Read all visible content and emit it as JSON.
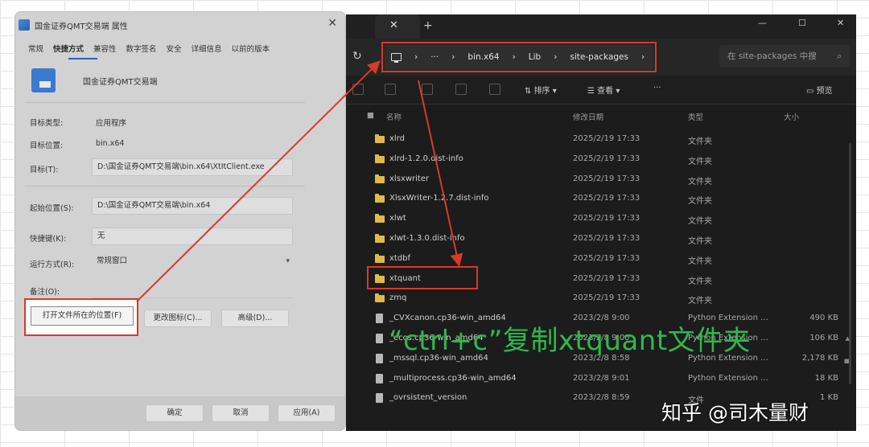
{
  "dialog": {
    "title": "国金证券QMT交易端 属性",
    "close_label": "✕",
    "tabs": [
      "常规",
      "快捷方式",
      "兼容性",
      "数字签名",
      "安全",
      "详细信息",
      "以前的版本"
    ],
    "app_name": "国金证券QMT交易端",
    "fields": {
      "target_type_label": "目标类型:",
      "target_type_value": "应用程序",
      "target_location_label": "目标位置:",
      "target_location_value": "bin.x64",
      "target_label": "目标(T):",
      "target_value": "D:\\国金证券QMT交易端\\bin.x64\\XtItClient.exe",
      "start_in_label": "起始位置(S):",
      "start_in_value": "D:\\国金证券QMT交易端\\bin.x64",
      "shortcut_key_label": "快捷键(K):",
      "shortcut_key_value": "无",
      "run_label": "运行方式(R):",
      "run_value": "常规窗口",
      "comment_label": "备注(O):",
      "comment_value": ""
    },
    "buttons": {
      "open_location": "打开文件所在的位置(F)",
      "change_icon": "更改图标(C)...",
      "advanced": "高级(D)..."
    },
    "footer": {
      "ok": "确定",
      "cancel": "取消",
      "apply": "应用(A)"
    }
  },
  "explorer": {
    "tab_close": "✕",
    "tab_add": "+",
    "window_controls": [
      "—",
      "☐",
      "✕"
    ],
    "breadcrumb": [
      "›",
      "···",
      "›",
      "bin.x64",
      "›",
      "Lib",
      "›",
      "site-packages",
      "›"
    ],
    "search_placeholder": "在 site-packages 中搜",
    "toolbar": {
      "sort": "排序",
      "view": "查看",
      "more": "···",
      "details": "预览"
    },
    "columns": {
      "name": "名称",
      "date": "修改日期",
      "type": "类型",
      "size": "大小"
    },
    "rows": [
      {
        "name": "xlrd",
        "date": "2025/2/19 17:33",
        "type": "文件夹",
        "size": "",
        "kind": "folder"
      },
      {
        "name": "xlrd-1.2.0.dist-info",
        "date": "2025/2/19 17:33",
        "type": "文件夹",
        "size": "",
        "kind": "folder"
      },
      {
        "name": "xlsxwriter",
        "date": "2025/2/19 17:33",
        "type": "文件夹",
        "size": "",
        "kind": "folder"
      },
      {
        "name": "XlsxWriter-1.2.7.dist-info",
        "date": "2025/2/19 17:33",
        "type": "文件夹",
        "size": "",
        "kind": "folder"
      },
      {
        "name": "xlwt",
        "date": "2025/2/19 17:33",
        "type": "文件夹",
        "size": "",
        "kind": "folder"
      },
      {
        "name": "xlwt-1.3.0.dist-info",
        "date": "2025/2/19 17:33",
        "type": "文件夹",
        "size": "",
        "kind": "folder"
      },
      {
        "name": "xtdbf",
        "date": "2025/2/19 17:33",
        "type": "文件夹",
        "size": "",
        "kind": "folder"
      },
      {
        "name": "xtquant",
        "date": "2025/2/19 17:33",
        "type": "文件夹",
        "size": "",
        "kind": "folder"
      },
      {
        "name": "zmq",
        "date": "2025/2/19 17:33",
        "type": "文件夹",
        "size": "",
        "kind": "folder"
      },
      {
        "name": "_CVXcanon.cp36-win_amd64",
        "date": "2023/2/8 9:00",
        "type": "Python Extension ...",
        "size": "490 KB",
        "kind": "file"
      },
      {
        "name": "_ecos.cp36-win_amd64",
        "date": "2023/2/8 9:00",
        "type": "Python Extension ...",
        "size": "106 KB",
        "kind": "file"
      },
      {
        "name": "_mssql.cp36-win_amd64",
        "date": "2023/2/8 8:58",
        "type": "Python Extension ...",
        "size": "2,178 KB",
        "kind": "file"
      },
      {
        "name": "_multiprocess.cp36-win_amd64",
        "date": "2023/2/8 9:01",
        "type": "Python Extension ...",
        "size": "18 KB",
        "kind": "file"
      },
      {
        "name": "_ovrsistent_version",
        "date": "2023/2/8 8:59",
        "type": "文件",
        "size": "1 KB",
        "kind": "file"
      }
    ]
  },
  "annotation": "“ctrl+c”复制xtquant文件夹",
  "watermark": "知乎 @司木量财",
  "colors": {
    "highlight_red": "#d63a2a",
    "annotation_green": "#2fb84e",
    "folder_yellow": "#e0b948"
  }
}
